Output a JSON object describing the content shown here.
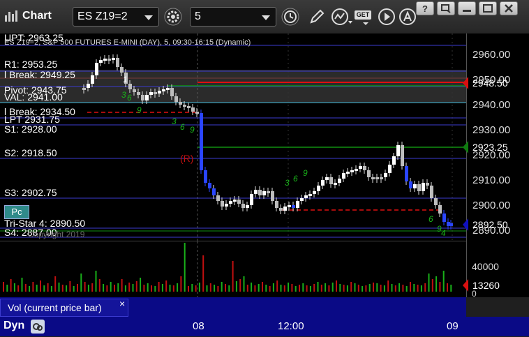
{
  "app": {
    "title": "Chart"
  },
  "toolbar": {
    "symbol": "ES Z19=2",
    "interval": "5",
    "get_label": "GET"
  },
  "chart": {
    "header": "ES Z19=2, S&P 500 FUTURES E-MINI (DAY), 5, 09:30-16:15 (Dynamic)",
    "levels": [
      {
        "label": "UPT: 2963.25"
      },
      {
        "label": "R1: 2953.25"
      },
      {
        "label": "l Break: 2949.25"
      },
      {
        "label": "Pivot: 2943.75"
      },
      {
        "label": "VAL: 2941.00"
      },
      {
        "label": "l Break: 2934.50"
      },
      {
        "label": "LPT 2931.75"
      },
      {
        "label": "S1: 2928.00"
      },
      {
        "label": "S2: 2918.50"
      },
      {
        "label": "S3: 2902.75"
      },
      {
        "label": "Tri-Star 4: 2890.50"
      },
      {
        "label": "S4: 2887.00"
      }
    ],
    "watermark": "Copyright 2019",
    "pc_button": "Pc",
    "marker_r": "(R)",
    "counts": [
      "1",
      "3",
      "6",
      "9",
      "3",
      "6",
      "9",
      "3",
      "6",
      "9",
      "6",
      "9",
      "4"
    ],
    "price_ticks": [
      "2960.00",
      "2950.00",
      "2940.00",
      "2930.00",
      "2920.00",
      "2910.00",
      "2900.00",
      "2890.00"
    ],
    "tags": [
      {
        "value": "2948.50",
        "color": "#d81010"
      },
      {
        "value": "2923.25",
        "color": "#0f7a10"
      },
      {
        "value": "2892.50",
        "color": "#1010c0"
      }
    ]
  },
  "volume": {
    "ticks": [
      "40000",
      "0"
    ],
    "current": "13260",
    "current_color": "#d81010",
    "label": "Vol (current price bar)",
    "close_glyph": "×"
  },
  "time_axis": {
    "symbol_short": "Dyn",
    "labels": [
      "08",
      "12:00",
      "09"
    ]
  }
}
